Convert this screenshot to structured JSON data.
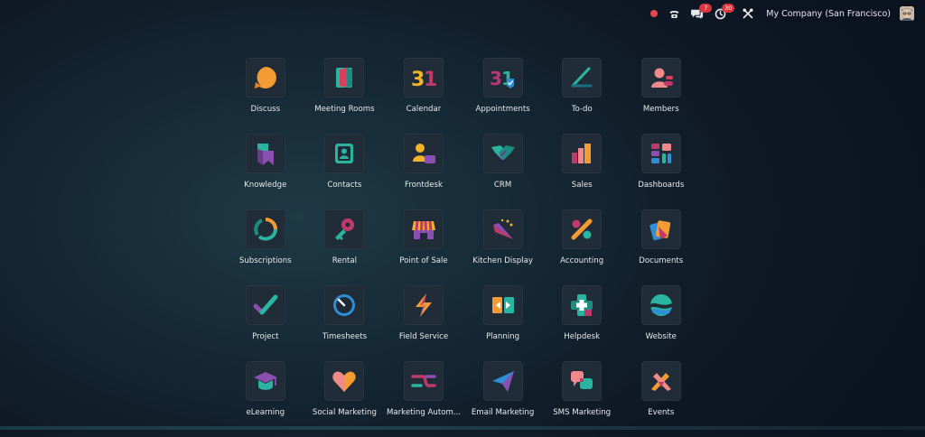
{
  "topbar": {
    "messages_badge": "7",
    "activities_badge": "30",
    "company": "My Company (San Francisco)"
  },
  "apps": [
    {
      "label": "Discuss",
      "icon": "discuss-icon"
    },
    {
      "label": "Meeting Rooms",
      "icon": "meeting-rooms-icon"
    },
    {
      "label": "Calendar",
      "icon": "calendar-icon"
    },
    {
      "label": "Appointments",
      "icon": "appointments-icon"
    },
    {
      "label": "To-do",
      "icon": "todo-icon"
    },
    {
      "label": "Members",
      "icon": "members-icon"
    },
    {
      "label": "Knowledge",
      "icon": "knowledge-icon"
    },
    {
      "label": "Contacts",
      "icon": "contacts-icon"
    },
    {
      "label": "Frontdesk",
      "icon": "frontdesk-icon"
    },
    {
      "label": "CRM",
      "icon": "crm-icon"
    },
    {
      "label": "Sales",
      "icon": "sales-icon"
    },
    {
      "label": "Dashboards",
      "icon": "dashboards-icon"
    },
    {
      "label": "Subscriptions",
      "icon": "subscriptions-icon"
    },
    {
      "label": "Rental",
      "icon": "rental-icon"
    },
    {
      "label": "Point of Sale",
      "icon": "point-of-sale-icon"
    },
    {
      "label": "Kitchen Display",
      "icon": "kitchen-display-icon"
    },
    {
      "label": "Accounting",
      "icon": "accounting-icon"
    },
    {
      "label": "Documents",
      "icon": "documents-icon"
    },
    {
      "label": "Project",
      "icon": "project-icon"
    },
    {
      "label": "Timesheets",
      "icon": "timesheets-icon"
    },
    {
      "label": "Field Service",
      "icon": "field-service-icon"
    },
    {
      "label": "Planning",
      "icon": "planning-icon"
    },
    {
      "label": "Helpdesk",
      "icon": "helpdesk-icon"
    },
    {
      "label": "Website",
      "icon": "website-icon"
    },
    {
      "label": "eLearning",
      "icon": "elearning-icon"
    },
    {
      "label": "Social Marketing",
      "icon": "social-marketing-icon"
    },
    {
      "label": "Marketing Autom...",
      "icon": "marketing-automation-icon"
    },
    {
      "label": "Email Marketing",
      "icon": "email-marketing-icon"
    },
    {
      "label": "SMS Marketing",
      "icon": "sms-marketing-icon"
    },
    {
      "label": "Events",
      "icon": "events-icon"
    }
  ]
}
